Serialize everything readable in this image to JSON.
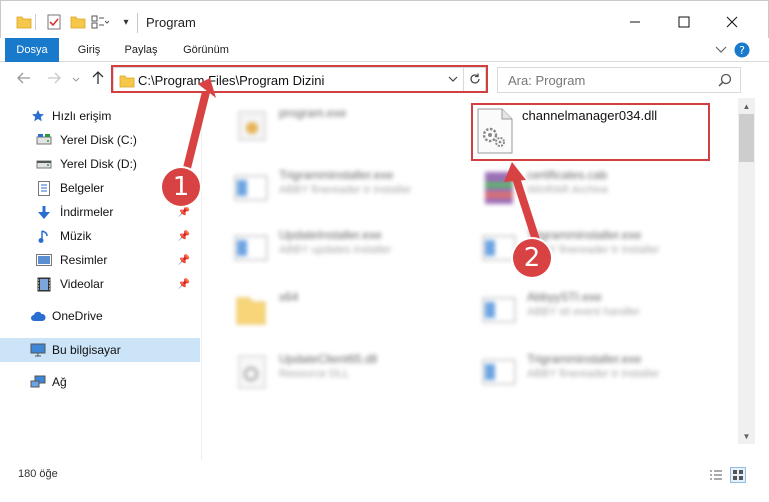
{
  "window": {
    "title": "Program",
    "controls": {
      "minimize": "minimize-icon",
      "maximize": "maximize-icon",
      "close": "close-icon"
    }
  },
  "ribbon": {
    "tabs": [
      "Dosya",
      "Giriş",
      "Paylaş",
      "Görünüm"
    ]
  },
  "nav": {
    "address_path": "C:\\Program Files\\Program Dizini",
    "search_placeholder": "Ara: Program"
  },
  "sidebar": {
    "items": [
      {
        "label": "Hızlı erişim",
        "icon": "star-icon"
      },
      {
        "label": "Yerel Disk (C:)",
        "icon": "drive-icon"
      },
      {
        "label": "Yerel Disk (D:)",
        "icon": "drive-icon"
      },
      {
        "label": "Belgeler",
        "icon": "document-icon"
      },
      {
        "label": "İndirmeler",
        "icon": "download-icon"
      },
      {
        "label": "Müzik",
        "icon": "music-icon"
      },
      {
        "label": "Resimler",
        "icon": "pictures-icon"
      },
      {
        "label": "Videolar",
        "icon": "video-icon"
      },
      {
        "label": "OneDrive",
        "icon": "cloud-icon"
      },
      {
        "label": "Bu bilgisayar",
        "icon": "computer-icon"
      },
      {
        "label": "Ağ",
        "icon": "network-icon"
      }
    ]
  },
  "files": [
    {
      "name": "program.exe",
      "type": ""
    },
    {
      "name": "channelmanager034.dll",
      "type": ""
    },
    {
      "name": "Trigramminstaller.exe",
      "type": "ABBY finereader tr installer"
    },
    {
      "name": "certificates.cab",
      "type": "WinRAR Archive"
    },
    {
      "name": "UpdateInstaller.exe",
      "type": "ABBY updates installer"
    },
    {
      "name": "Trigramminstaller.exe",
      "type": "ABBY finereader tr installer"
    },
    {
      "name": "x64",
      "type": ""
    },
    {
      "name": "AbbyySTI.exe",
      "type": "ABBY sti event handler"
    },
    {
      "name": "UpdateClient65.dll",
      "type": "Resource DLL"
    },
    {
      "name": "Trigramminstaller.exe",
      "type": "ABBY finereader tr installer"
    }
  ],
  "status": {
    "item_count": "180 öğe"
  },
  "markers": [
    "1",
    "2"
  ],
  "colors": {
    "accent": "#1979ca",
    "highlight": "#d33f40",
    "marker": "#d94242",
    "selected": "#cce4f7"
  }
}
